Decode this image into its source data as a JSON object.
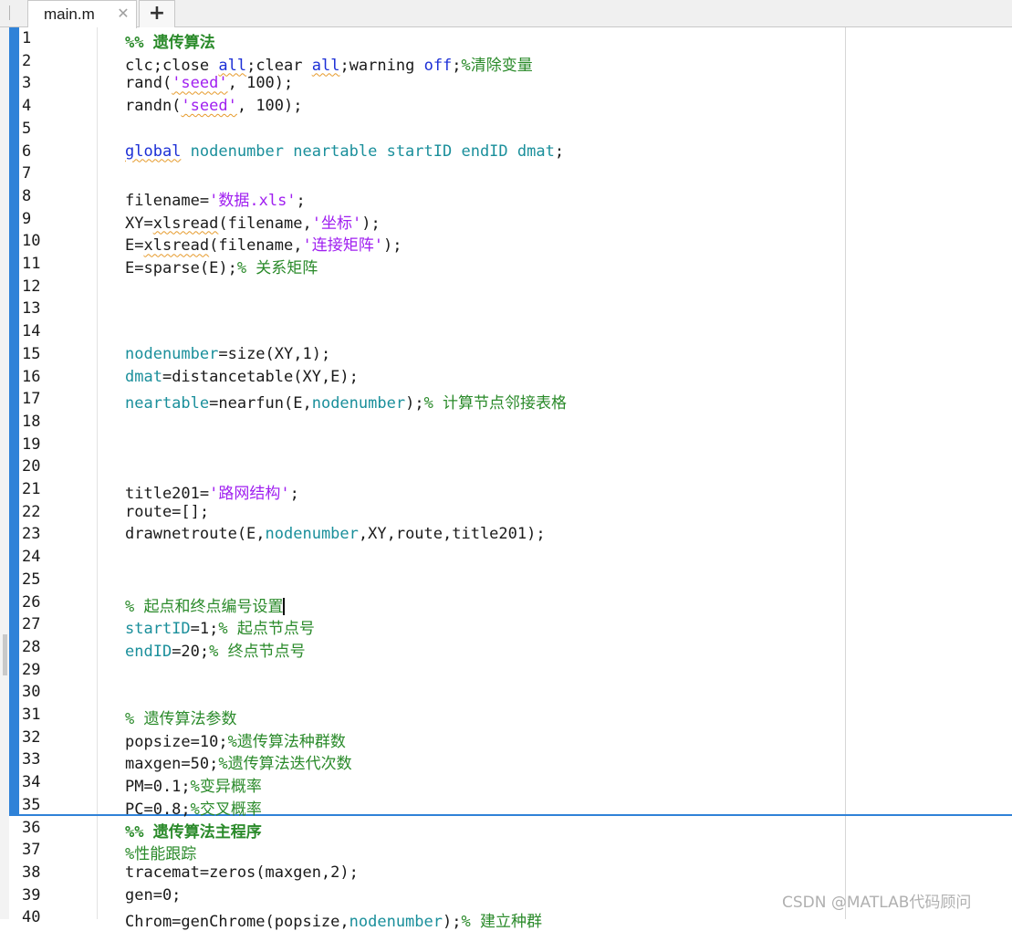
{
  "tabs": {
    "active_file": "main.m",
    "close_glyph": "✕",
    "add_glyph": "+"
  },
  "watermark": "CSDN @MATLAB代码顾问",
  "colors": {
    "comment": "#2a8a2a",
    "keyword": "#1c2fd6",
    "global_var": "#1a8f9b",
    "string": "#a020f0",
    "change_bar": "#2f82d8"
  },
  "editor": {
    "lines": [
      {
        "n": "1",
        "tokens": [
          {
            "t": "%% 遗传算法",
            "c": "sec"
          }
        ]
      },
      {
        "n": "2",
        "tokens": [
          {
            "t": "clc;close ",
            "c": ""
          },
          {
            "t": "all",
            "c": "kw",
            "u": true
          },
          {
            "t": ";clear ",
            "c": ""
          },
          {
            "t": "all",
            "c": "kw",
            "u": true
          },
          {
            "t": ";warning ",
            "c": ""
          },
          {
            "t": "off",
            "c": "kw"
          },
          {
            "t": ";",
            "c": ""
          },
          {
            "t": "%清除变量",
            "c": "cm"
          }
        ]
      },
      {
        "n": "3",
        "tokens": [
          {
            "t": "rand(",
            "c": ""
          },
          {
            "t": "'seed'",
            "c": "str",
            "u": true
          },
          {
            "t": ", 100);",
            "c": ""
          }
        ]
      },
      {
        "n": "4",
        "tokens": [
          {
            "t": "randn(",
            "c": ""
          },
          {
            "t": "'seed'",
            "c": "str",
            "u": true
          },
          {
            "t": ", 100);",
            "c": ""
          }
        ]
      },
      {
        "n": "5",
        "tokens": []
      },
      {
        "n": "6",
        "tokens": [
          {
            "t": "global",
            "c": "kw",
            "u": true
          },
          {
            "t": " nodenumber neartable startID endID dmat",
            "c": "glob"
          },
          {
            "t": ";",
            "c": ""
          }
        ]
      },
      {
        "n": "7",
        "tokens": []
      },
      {
        "n": "8",
        "tokens": [
          {
            "t": "filename=",
            "c": ""
          },
          {
            "t": "'数据.xls'",
            "c": "str"
          },
          {
            "t": ";",
            "c": ""
          }
        ]
      },
      {
        "n": "9",
        "tokens": [
          {
            "t": "XY=",
            "c": ""
          },
          {
            "t": "xlsread",
            "c": "",
            "u": true
          },
          {
            "t": "(filename,",
            "c": ""
          },
          {
            "t": "'坐标'",
            "c": "str"
          },
          {
            "t": ");",
            "c": ""
          }
        ]
      },
      {
        "n": "10",
        "tokens": [
          {
            "t": "E=",
            "c": ""
          },
          {
            "t": "xlsread",
            "c": "",
            "u": true
          },
          {
            "t": "(filename,",
            "c": ""
          },
          {
            "t": "'连接矩阵'",
            "c": "str"
          },
          {
            "t": ");",
            "c": ""
          }
        ]
      },
      {
        "n": "11",
        "tokens": [
          {
            "t": "E=sparse(E);",
            "c": ""
          },
          {
            "t": "% 关系矩阵",
            "c": "cm"
          }
        ]
      },
      {
        "n": "12",
        "tokens": []
      },
      {
        "n": "13",
        "tokens": []
      },
      {
        "n": "14",
        "tokens": []
      },
      {
        "n": "15",
        "tokens": [
          {
            "t": "nodenumber",
            "c": "glob"
          },
          {
            "t": "=size(XY,1);",
            "c": ""
          }
        ]
      },
      {
        "n": "16",
        "tokens": [
          {
            "t": "dmat",
            "c": "glob"
          },
          {
            "t": "=distancetable(XY,E);",
            "c": ""
          }
        ]
      },
      {
        "n": "17",
        "tokens": [
          {
            "t": "neartable",
            "c": "glob"
          },
          {
            "t": "=nearfun(E,",
            "c": ""
          },
          {
            "t": "nodenumber",
            "c": "glob"
          },
          {
            "t": ");",
            "c": ""
          },
          {
            "t": "% 计算节点邻接表格",
            "c": "cm"
          }
        ]
      },
      {
        "n": "18",
        "tokens": []
      },
      {
        "n": "19",
        "tokens": []
      },
      {
        "n": "20",
        "tokens": []
      },
      {
        "n": "21",
        "tokens": [
          {
            "t": "title201=",
            "c": ""
          },
          {
            "t": "'路网结构'",
            "c": "str"
          },
          {
            "t": ";",
            "c": ""
          }
        ]
      },
      {
        "n": "22",
        "tokens": [
          {
            "t": "route=[];",
            "c": ""
          }
        ]
      },
      {
        "n": "23",
        "tokens": [
          {
            "t": "drawnetroute(E,",
            "c": ""
          },
          {
            "t": "nodenumber",
            "c": "glob"
          },
          {
            "t": ",XY,route,title201);",
            "c": ""
          }
        ]
      },
      {
        "n": "24",
        "tokens": []
      },
      {
        "n": "25",
        "tokens": []
      },
      {
        "n": "26",
        "tokens": [
          {
            "t": "% 起点和终点编号设置",
            "c": "cm"
          }
        ],
        "caret": true
      },
      {
        "n": "27",
        "tokens": [
          {
            "t": "startID",
            "c": "glob"
          },
          {
            "t": "=1;",
            "c": ""
          },
          {
            "t": "% 起点节点号",
            "c": "cm"
          }
        ]
      },
      {
        "n": "28",
        "tokens": [
          {
            "t": "endID",
            "c": "glob"
          },
          {
            "t": "=20;",
            "c": ""
          },
          {
            "t": "% 终点节点号",
            "c": "cm"
          }
        ]
      },
      {
        "n": "29",
        "tokens": []
      },
      {
        "n": "30",
        "tokens": []
      },
      {
        "n": "31",
        "tokens": [
          {
            "t": "% 遗传算法参数",
            "c": "cm"
          }
        ]
      },
      {
        "n": "32",
        "tokens": [
          {
            "t": "popsize=10;",
            "c": ""
          },
          {
            "t": "%遗传算法种群数",
            "c": "cm"
          }
        ]
      },
      {
        "n": "33",
        "tokens": [
          {
            "t": "maxgen=50;",
            "c": ""
          },
          {
            "t": "%遗传算法迭代次数",
            "c": "cm"
          }
        ]
      },
      {
        "n": "34",
        "tokens": [
          {
            "t": "PM=0.1;",
            "c": ""
          },
          {
            "t": "%变异概率",
            "c": "cm"
          }
        ]
      },
      {
        "n": "35",
        "tokens": [
          {
            "t": "PC=0.8;",
            "c": ""
          },
          {
            "t": "%交叉概率",
            "c": "cm"
          }
        ]
      },
      {
        "n": "36",
        "tokens": [
          {
            "t": "%% 遗传算法主程序",
            "c": "sec"
          }
        ]
      },
      {
        "n": "37",
        "tokens": [
          {
            "t": "%性能跟踪",
            "c": "cm"
          }
        ]
      },
      {
        "n": "38",
        "tokens": [
          {
            "t": "tracemat=zeros(maxgen,2);",
            "c": ""
          }
        ]
      },
      {
        "n": "39",
        "tokens": [
          {
            "t": "gen=0;",
            "c": ""
          }
        ]
      },
      {
        "n": "40",
        "tokens": [
          {
            "t": "Chrom=genChrome(popsize,",
            "c": ""
          },
          {
            "t": "nodenumber",
            "c": "glob"
          },
          {
            "t": ");",
            "c": ""
          },
          {
            "t": "% 建立种群",
            "c": "cm"
          }
        ]
      }
    ]
  }
}
